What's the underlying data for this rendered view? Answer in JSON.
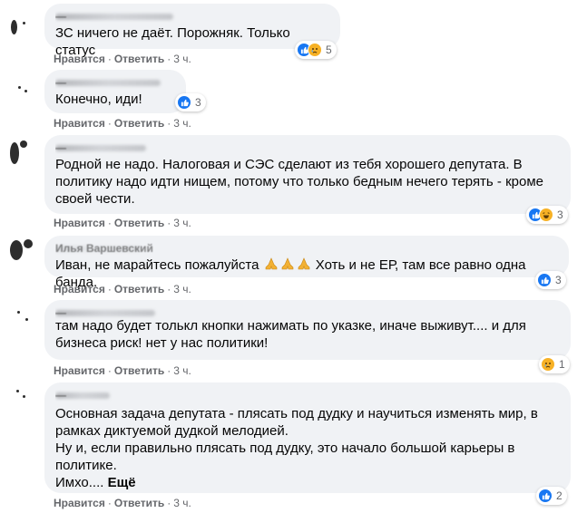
{
  "actions": {
    "like": "Нравится",
    "reply": "Ответить",
    "separator": "·"
  },
  "comments": [
    {
      "author": "—",
      "text": "ЗС ничего не даёт. Порожняк. Только статус",
      "time": "3 ч.",
      "reactions": [
        "like",
        "sad"
      ],
      "reaction_count": "5"
    },
    {
      "author": "—",
      "text": "Конечно, иди!",
      "time": "3 ч.",
      "reactions": [
        "like"
      ],
      "reaction_count": "3"
    },
    {
      "author": "—",
      "text": "Родной не надо. Налоговая и СЭС сделают из тебя хорошего депутата. В\nполитику надо идти нищем, потому что только бедным нечего терять - кроме\nсвоей чести.",
      "time": "3 ч.",
      "reactions": [
        "like",
        "haha"
      ],
      "reaction_count": "3"
    },
    {
      "author": "Илья Варшевский",
      "text_before": "Иван, не марайтесь пожалуйста",
      "text_after": "Хоть и не ЕР, там все равно одна банда.",
      "time": "3 ч.",
      "reactions": [
        "like"
      ],
      "reaction_count": "3"
    },
    {
      "author": "—",
      "text": "там надо будет толькл кнопки нажимать по указке, иначе выживут.... и для\nбизнеса риск! нет у нас политики!",
      "time": "3 ч.",
      "reactions": [
        "sad"
      ],
      "reaction_count": "1"
    },
    {
      "author": "—",
      "text": "Основная задача депутата - плясать под дудку и научиться изменять мир, в\nрамках диктуемой дудкой мелодией.\nНу и, если правильно плясать под дудку, это начало большой карьеры в\nполитике.\nИмхо....",
      "more": "Ещё",
      "time": "3 ч.",
      "reactions": [
        "like"
      ],
      "reaction_count": "2"
    }
  ],
  "colors": {
    "bubble": "#f0f2f5",
    "meta": "#65676b",
    "like": "#1877f2",
    "emoji": "#f7b125"
  }
}
